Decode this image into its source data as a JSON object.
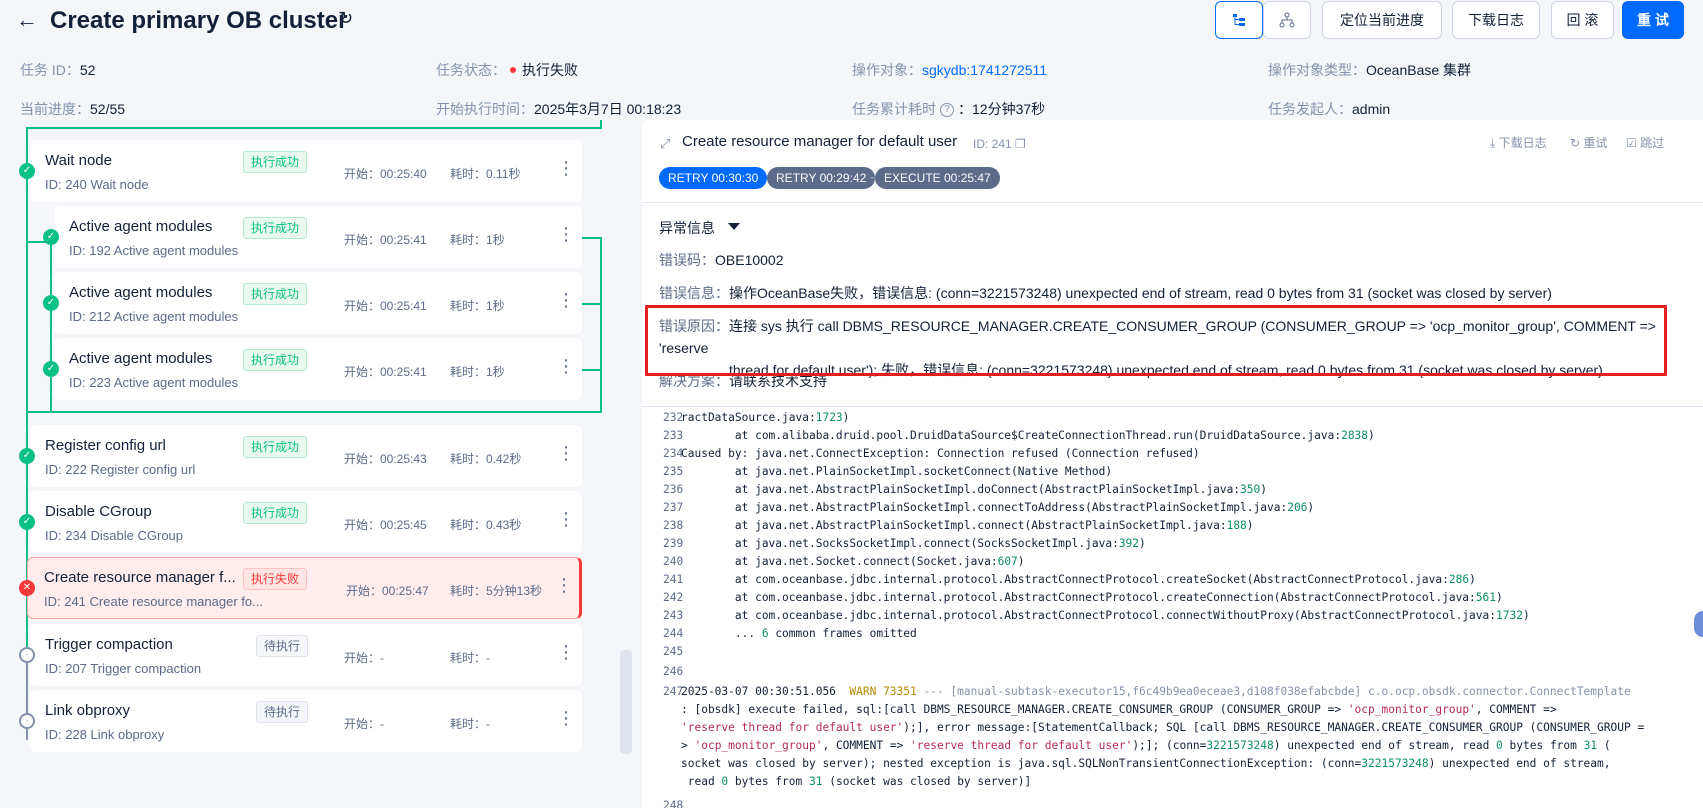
{
  "header": {
    "title": "Create primary OB cluster",
    "buttons": {
      "locate": "定位当前进度",
      "download": "下载日志",
      "rollback": "回 滚",
      "retry": "重 试"
    }
  },
  "meta": {
    "task_id_k": "任务 ID：",
    "task_id": "52",
    "status_k": "任务状态：",
    "status": "执行失败",
    "target_k": "操作对象：",
    "target": "sgkydb:1741272511",
    "type_k": "操作对象类型：",
    "type": "OceanBase 集群",
    "progress_k": "当前进度：",
    "progress": "52/55",
    "start_k": "开始执行时间：",
    "start": "2025年3月7日 00:18:23",
    "elapsed_k": "任务累计耗时",
    "elapsed": "：12分钟37秒",
    "creator_k": "任务发起人：",
    "creator": "admin"
  },
  "nodes": [
    {
      "name": "Wait node",
      "sub": "ID: 240  Wait node",
      "tag": "执行成功",
      "start": "开始：00:25:40",
      "cost": "耗时：0.11秒"
    },
    {
      "name": "Active agent modules",
      "sub": "ID: 192  Active agent modules",
      "tag": "执行成功",
      "start": "开始：00:25:41",
      "cost": "耗时：1秒"
    },
    {
      "name": "Active agent modules",
      "sub": "ID: 212  Active agent modules",
      "tag": "执行成功",
      "start": "开始：00:25:41",
      "cost": "耗时：1秒"
    },
    {
      "name": "Active agent modules",
      "sub": "ID: 223  Active agent modules",
      "tag": "执行成功",
      "start": "开始：00:25:41",
      "cost": "耗时：1秒"
    },
    {
      "name": "Register config url",
      "sub": "ID: 222  Register config url",
      "tag": "执行成功",
      "start": "开始：00:25:43",
      "cost": "耗时：0.42秒"
    },
    {
      "name": "Disable CGroup",
      "sub": "ID: 234  Disable CGroup",
      "tag": "执行成功",
      "start": "开始：00:25:45",
      "cost": "耗时：0.43秒"
    },
    {
      "name": "Create resource manager f...",
      "sub": "ID: 241  Create resource manager fo...",
      "tag": "执行失败",
      "start": "开始：00:25:47",
      "cost": "耗时：5分钟13秒"
    },
    {
      "name": "Trigger compaction",
      "sub": "ID: 207  Trigger compaction",
      "tag": "待执行",
      "start": "开始：-",
      "cost": "耗时：-"
    },
    {
      "name": "Link obproxy",
      "sub": "ID: 228  Link obproxy",
      "tag": "待执行",
      "start": "开始：-",
      "cost": "耗时：-"
    }
  ],
  "detail": {
    "title": "Create resource manager for default user",
    "id": "ID: 241",
    "actions": {
      "download": "下载日志",
      "retry": "重试",
      "skip": "跳过"
    },
    "pills": [
      "RETRY 00:30:30",
      "RETRY 00:29:42",
      "EXECUTE 00:25:47"
    ],
    "exc_title": "异常信息",
    "code_k": "错误码：",
    "code": "OBE10002",
    "msg_k": "错误信息：",
    "msg": "操作OceanBase失败，错误信息: (conn=3221573248) unexpected end of stream, read 0 bytes from 31 (socket was closed by server)",
    "reason_k": "错误原因：",
    "reason1": "连接 sys 执行 call DBMS_RESOURCE_MANAGER.CREATE_CONSUMER_GROUP (CONSUMER_GROUP => 'ocp_monitor_group', COMMENT => 'reserve",
    "reason2": "thread for default user'); 失败，错误信息: (conn=3221573248) unexpected end of stream, read 0 bytes from 31 (socket was closed by server)",
    "solution_k": "解决方案：",
    "solution": "请联系技术支持"
  },
  "log": [
    {
      "n": "232",
      "t": "ractDataSource.java:",
      "num": "1723",
      "e": ")"
    },
    {
      "n": "233",
      "t": "        at com.alibaba.druid.pool.DruidDataSource$CreateConnectionThread.run(DruidDataSource.java:",
      "num": "2838",
      "e": ")"
    },
    {
      "n": "234",
      "t": "Caused by: java.net.ConnectException: Connection refused (Connection refused)",
      "num": "",
      "e": ""
    },
    {
      "n": "235",
      "t": "        at java.net.PlainSocketImpl.socketConnect(Native Method)",
      "num": "",
      "e": ""
    },
    {
      "n": "236",
      "t": "        at java.net.AbstractPlainSocketImpl.doConnect(AbstractPlainSocketImpl.java:",
      "num": "350",
      "e": ")"
    },
    {
      "n": "237",
      "t": "        at java.net.AbstractPlainSocketImpl.connectToAddress(AbstractPlainSocketImpl.java:",
      "num": "206",
      "e": ")"
    },
    {
      "n": "238",
      "t": "        at java.net.AbstractPlainSocketImpl.connect(AbstractPlainSocketImpl.java:",
      "num": "188",
      "e": ")"
    },
    {
      "n": "239",
      "t": "        at java.net.SocksSocketImpl.connect(SocksSocketImpl.java:",
      "num": "392",
      "e": ")"
    },
    {
      "n": "240",
      "t": "        at java.net.Socket.connect(Socket.java:",
      "num": "607",
      "e": ")"
    },
    {
      "n": "241",
      "t": "        at com.oceanbase.jdbc.internal.protocol.AbstractConnectProtocol.createSocket(AbstractConnectProtocol.java:",
      "num": "286",
      "e": ")"
    },
    {
      "n": "242",
      "t": "        at com.oceanbase.jdbc.internal.protocol.AbstractConnectProtocol.createConnection(AbstractConnectProtocol.java:",
      "num": "561",
      "e": ")"
    },
    {
      "n": "243",
      "t": "        at com.oceanbase.jdbc.internal.protocol.AbstractConnectProtocol.connectWithoutProxy(AbstractConnectProtocol.java:",
      "num": "1732",
      "e": ")"
    },
    {
      "n": "244",
      "t": "        ... ",
      "num": "6",
      "e": " common frames omitted"
    },
    {
      "n": "245",
      "t": "",
      "num": "",
      "e": ""
    },
    {
      "n": "246",
      "t": "",
      "num": "",
      "e": ""
    }
  ],
  "log_warn": {
    "n": "247",
    "l1a": "2025-03-07 00:30:51.056  ",
    "l1w": "WARN 73351",
    "l1b": " --- [manual-subtask-executor15,f6c49b9ea0eceae3,d108f038efabcbde] c.o.ocp.obsdk.connector.ConnectTemplate",
    "l2a": ": [obsdk] execute failed, sql:[call DBMS_RESOURCE_MANAGER.CREATE_CONSUMER_GROUP (CONSUMER_GROUP => ",
    "l2s": "'ocp_monitor_group'",
    "l2b": ", COMMENT =>",
    "l3s": "'reserve thread for default user'",
    "l3b": ");], error message:[StatementCallback; SQL [call DBMS_RESOURCE_MANAGER.CREATE_CONSUMER_GROUP (CONSUMER_GROUP =",
    "l4a": "> ",
    "l4s": "'ocp_monitor_group'",
    "l4b": ", COMMENT => ",
    "l4s2": "'reserve thread for default user'",
    "l4c": ");]; (conn=",
    "l4n": "3221573248",
    "l4d": ") unexpected end of stream, read ",
    "l4n2": "0",
    "l4e": " bytes from ",
    "l4n3": "31",
    "l4f": " (",
    "l5a": "socket was closed by server); nested exception is java.sql.SQLNonTransientConnectionException: (conn=",
    "l5n": "3221573248",
    "l5b": ") unexpected end of stream,",
    "l6a": " read ",
    "l6n": "0",
    "l6b": " bytes from ",
    "l6n2": "31",
    "l6c": " (socket was closed by server)]",
    "next": "248"
  }
}
